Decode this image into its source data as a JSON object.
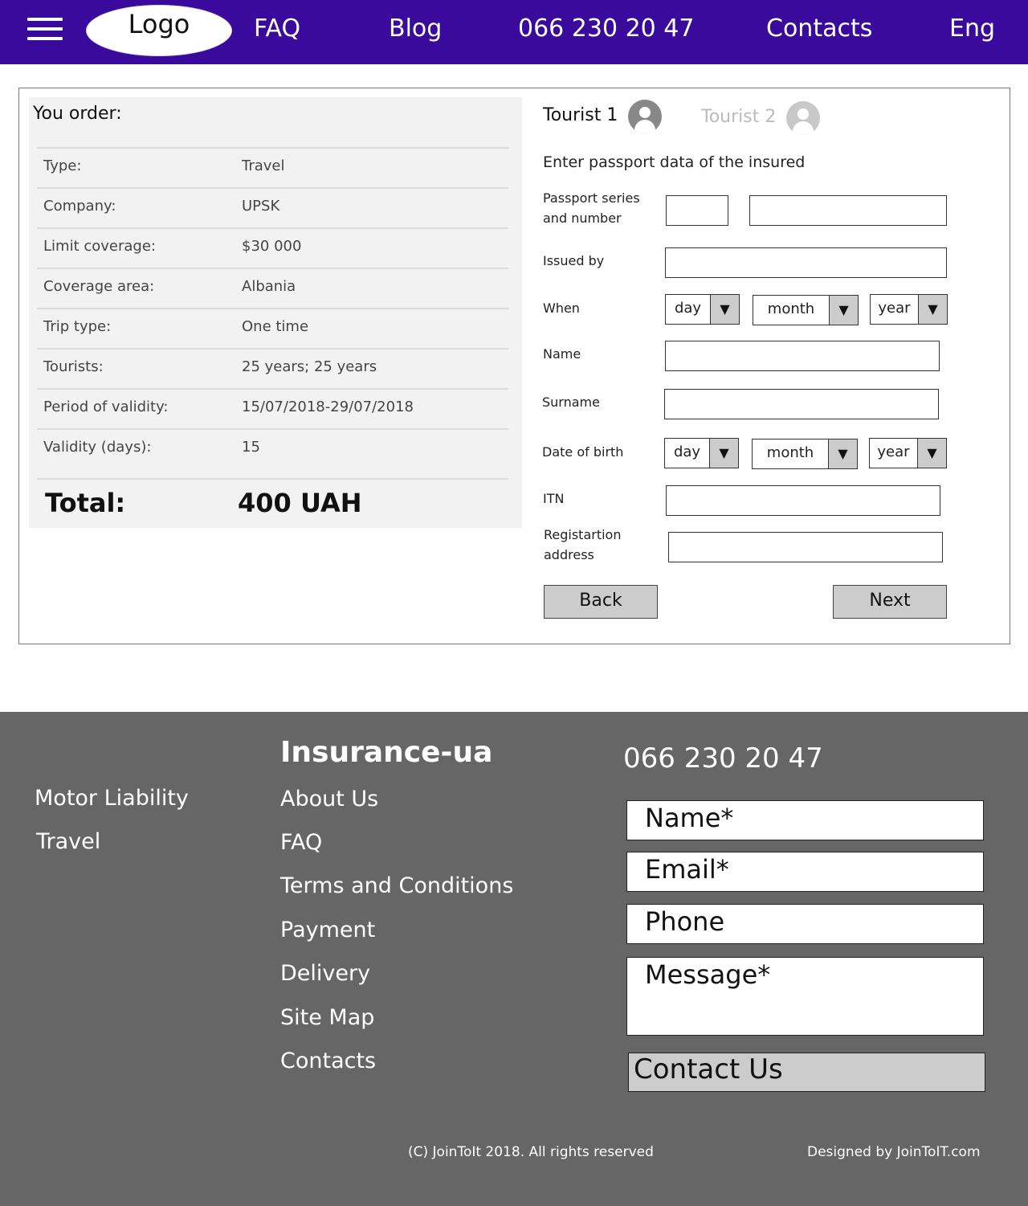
{
  "header": {
    "logo": "Logo",
    "nav": [
      "FAQ",
      "Blog",
      "066 230 20 47",
      "Contacts",
      "Eng"
    ]
  },
  "order": {
    "title": "You order:",
    "rows": [
      {
        "label": "Type:",
        "value": "Travel"
      },
      {
        "label": "Company:",
        "value": "UPSK"
      },
      {
        "label": "Limit coverage:",
        "value": "$30 000"
      },
      {
        "label": "Coverage area:",
        "value": "Albania"
      },
      {
        "label": "Trip type:",
        "value": "One time"
      },
      {
        "label": "Tourists:",
        "value": "25 years; 25 years"
      },
      {
        "label": "Period of validity:",
        "value": "15/07/2018-29/07/2018"
      },
      {
        "label": "Validity (days):",
        "value": "15"
      }
    ],
    "total_label": "Total:",
    "total_value": "400 UAH"
  },
  "form": {
    "tourist1": "Tourist 1",
    "tourist2": "Tourist 2",
    "hint": "Enter passport data of the insured",
    "passport_label_1": "Passport series",
    "passport_label_2": "and number",
    "issued_by": "Issued by",
    "when": "When",
    "name": "Name",
    "surname": "Surname",
    "dob": "Date of birth",
    "itn": "ITN",
    "reg_label_1": "Registartion",
    "reg_label_2": "address",
    "day": "day",
    "month": "month",
    "year": "year",
    "back": "Back",
    "next": "Next"
  },
  "footer": {
    "col1": [
      "Motor Liability",
      "Travel"
    ],
    "brand": "Insurance-ua",
    "col2": [
      "About Us",
      "FAQ",
      "Terms and Conditions",
      "Payment",
      "Delivery",
      "Site Map",
      "Contacts"
    ],
    "phone": "066 230 20 47",
    "name_ph": "Name*",
    "email_ph": "Email*",
    "phone_ph": "Phone",
    "message_ph": "Message*",
    "contact_btn": "Contact Us",
    "copyright": "(C) JoinToIt 2018. All rights reserved",
    "designed": "Designed by JoinToIT.com"
  }
}
